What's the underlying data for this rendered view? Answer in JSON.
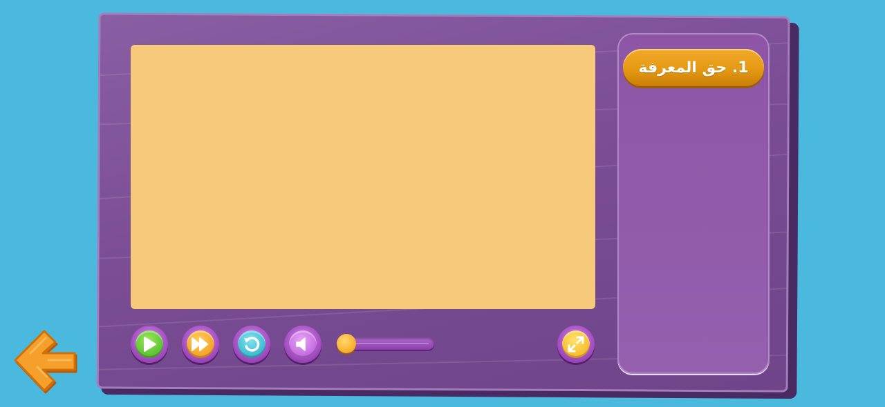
{
  "panel": {
    "title": "1. حق المعرفة"
  },
  "controls": {
    "play_icon": "play-icon",
    "fast_forward_icon": "fast-forward-icon",
    "replay_icon": "replay-icon",
    "volume_icon": "volume-icon",
    "fullscreen_icon": "fullscreen-icon",
    "back_icon": "back-arrow-icon",
    "progress": 0.0
  },
  "colors": {
    "background": "#4bb8de",
    "board": "#7a4d95",
    "screen": "#f7ca7b",
    "title_pill": "#e59913",
    "back_arrow": "#f39a1e"
  }
}
